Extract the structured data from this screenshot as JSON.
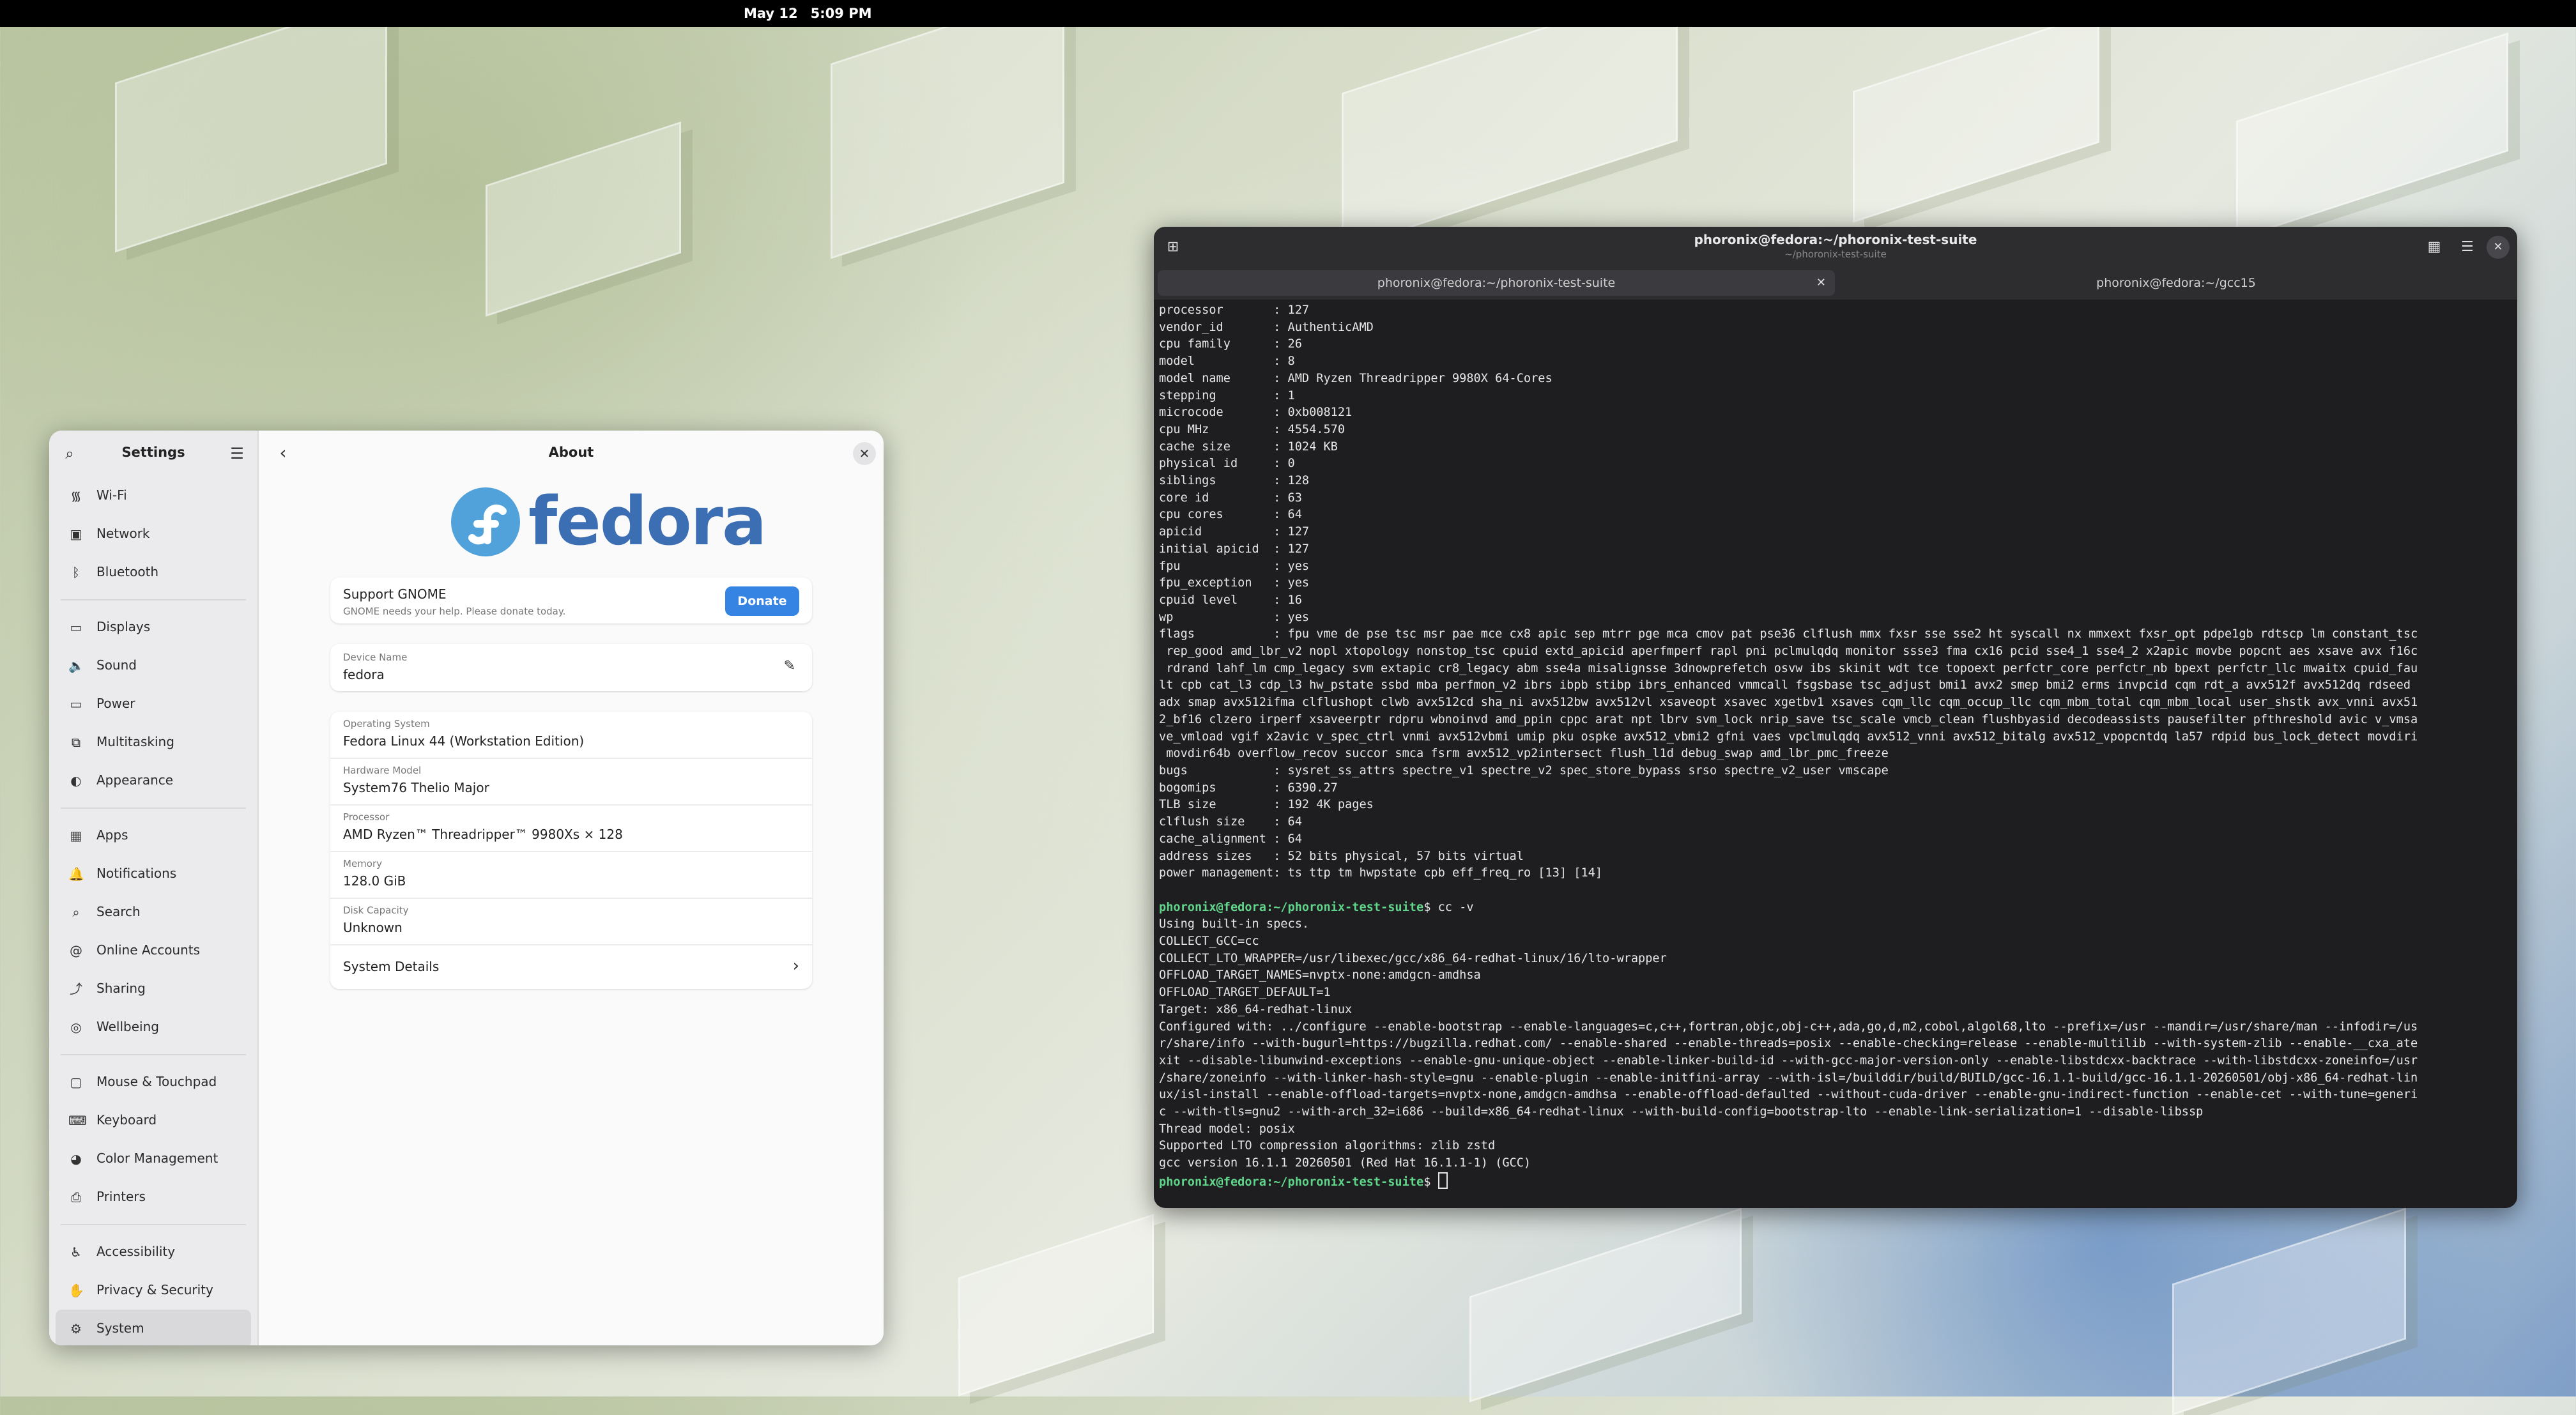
{
  "topbar": {
    "date": "May 12",
    "time": "5:09 PM"
  },
  "settings": {
    "sidebar_title": "Settings",
    "groups": [
      [
        {
          "label": "Wi-Fi",
          "icon": "wifi-icon",
          "glyph": "᯾"
        },
        {
          "label": "Network",
          "icon": "network-icon",
          "glyph": "▣"
        },
        {
          "label": "Bluetooth",
          "icon": "bluetooth-icon",
          "glyph": "ᛒ"
        }
      ],
      [
        {
          "label": "Displays",
          "icon": "display-icon",
          "glyph": "▭"
        },
        {
          "label": "Sound",
          "icon": "sound-icon",
          "glyph": "🔈"
        },
        {
          "label": "Power",
          "icon": "power-icon",
          "glyph": "▭"
        },
        {
          "label": "Multitasking",
          "icon": "multitasking-icon",
          "glyph": "⧉"
        },
        {
          "label": "Appearance",
          "icon": "appearance-icon",
          "glyph": "◐"
        }
      ],
      [
        {
          "label": "Apps",
          "icon": "apps-icon",
          "glyph": "▦"
        },
        {
          "label": "Notifications",
          "icon": "notifications-icon",
          "glyph": "🔔"
        },
        {
          "label": "Search",
          "icon": "search-icon",
          "glyph": "⌕"
        },
        {
          "label": "Online Accounts",
          "icon": "online-accounts-icon",
          "glyph": "@"
        },
        {
          "label": "Sharing",
          "icon": "sharing-icon",
          "glyph": "⤴"
        },
        {
          "label": "Wellbeing",
          "icon": "wellbeing-icon",
          "glyph": "◎"
        }
      ],
      [
        {
          "label": "Mouse & Touchpad",
          "icon": "mouse-icon",
          "glyph": "▢"
        },
        {
          "label": "Keyboard",
          "icon": "keyboard-icon",
          "glyph": "⌨"
        },
        {
          "label": "Color Management",
          "icon": "color-management-icon",
          "glyph": "◕"
        },
        {
          "label": "Printers",
          "icon": "printer-icon",
          "glyph": "⎙"
        }
      ],
      [
        {
          "label": "Accessibility",
          "icon": "accessibility-icon",
          "glyph": "♿"
        },
        {
          "label": "Privacy & Security",
          "icon": "privacy-icon",
          "glyph": "✋"
        },
        {
          "label": "System",
          "icon": "system-icon",
          "glyph": "⚙",
          "active": true
        }
      ]
    ],
    "about": {
      "title": "About",
      "logo_text": "fedora",
      "donate": {
        "title": "Support GNOME",
        "subtitle": "GNOME needs your help. Please donate today.",
        "button": "Donate"
      },
      "device": {
        "label": "Device Name",
        "value": "fedora"
      },
      "info": [
        {
          "label": "Operating System",
          "value": "Fedora Linux 44 (Workstation Edition)"
        },
        {
          "label": "Hardware Model",
          "value": "System76 Thelio Major"
        },
        {
          "label": "Processor",
          "value": "AMD Ryzen™ Threadripper™ 9980Xs × 128"
        },
        {
          "label": "Memory",
          "value": "128.0 GiB"
        },
        {
          "label": "Disk Capacity",
          "value": "Unknown"
        }
      ],
      "details": "System Details"
    }
  },
  "terminal": {
    "title": "phoronix@fedora:~/phoronix-test-suite",
    "subtitle": "~/phoronix-test-suite",
    "tabs": [
      "phoronix@fedora:~/phoronix-test-suite",
      "phoronix@fedora:~/gcc15"
    ],
    "lines": [
      "processor       : 127",
      "vendor_id       : AuthenticAMD",
      "cpu family      : 26",
      "model           : 8",
      "model name      : AMD Ryzen Threadripper 9980X 64-Cores",
      "stepping        : 1",
      "microcode       : 0xb008121",
      "cpu MHz         : 4554.570",
      "cache size      : 1024 KB",
      "physical id     : 0",
      "siblings        : 128",
      "core id         : 63",
      "cpu cores       : 64",
      "apicid          : 127",
      "initial apicid  : 127",
      "fpu             : yes",
      "fpu_exception   : yes",
      "cpuid level     : 16",
      "wp              : yes",
      "flags           : fpu vme de pse tsc msr pae mce cx8 apic sep mtrr pge mca cmov pat pse36 clflush mmx fxsr sse sse2 ht syscall nx mmxext fxsr_opt pdpe1gb rdtscp lm constant_tsc",
      " rep_good amd_lbr_v2 nopl xtopology nonstop_tsc cpuid extd_apicid aperfmperf rapl pni pclmulqdq monitor ssse3 fma cx16 pcid sse4_1 sse4_2 x2apic movbe popcnt aes xsave avx f16c",
      " rdrand lahf_lm cmp_legacy svm extapic cr8_legacy abm sse4a misalignsse 3dnowprefetch osvw ibs skinit wdt tce topoext perfctr_core perfctr_nb bpext perfctr_llc mwaitx cpuid_fau",
      "lt cpb cat_l3 cdp_l3 hw_pstate ssbd mba perfmon_v2 ibrs ibpb stibp ibrs_enhanced vmmcall fsgsbase tsc_adjust bmi1 avx2 smep bmi2 erms invpcid cqm rdt_a avx512f avx512dq rdseed",
      "adx smap avx512ifma clflushopt clwb avx512cd sha_ni avx512bw avx512vl xsaveopt xsavec xgetbv1 xsaves cqm_llc cqm_occup_llc cqm_mbm_total cqm_mbm_local user_shstk avx_vnni avx51",
      "2_bf16 clzero irperf xsaveerptr rdpru wbnoinvd amd_ppin cppc arat npt lbrv svm_lock nrip_save tsc_scale vmcb_clean flushbyasid decodeassists pausefilter pfthreshold avic v_vmsa",
      "ve_vmload vgif x2avic v_spec_ctrl vnmi avx512vbmi umip pku ospke avx512_vbmi2 gfni vaes vpclmulqdq avx512_vnni avx512_bitalg avx512_vpopcntdq la57 rdpid bus_lock_detect movdiri",
      " movdir64b overflow_recov succor smca fsrm avx512_vp2intersect flush_l1d debug_swap amd_lbr_pmc_freeze",
      "bugs            : sysret_ss_attrs spectre_v1 spectre_v2 spec_store_bypass srso spectre_v2_user vmscape",
      "bogomips        : 6390.27",
      "TLB size        : 192 4K pages",
      "clflush size    : 64",
      "cache_alignment : 64",
      "address sizes   : 52 bits physical, 57 bits virtual",
      "power management: ts ttp tm hwpstate cpb eff_freq_ro [13] [14]",
      "",
      "$ cc -v",
      "Using built-in specs.",
      "COLLECT_GCC=cc",
      "COLLECT_LTO_WRAPPER=/usr/libexec/gcc/x86_64-redhat-linux/16/lto-wrapper",
      "OFFLOAD_TARGET_NAMES=nvptx-none:amdgcn-amdhsa",
      "OFFLOAD_TARGET_DEFAULT=1",
      "Target: x86_64-redhat-linux",
      "Configured with: ../configure --enable-bootstrap --enable-languages=c,c++,fortran,objc,obj-c++,ada,go,d,m2,cobol,algol68,lto --prefix=/usr --mandir=/usr/share/man --infodir=/us",
      "r/share/info --with-bugurl=https://bugzilla.redhat.com/ --enable-shared --enable-threads=posix --enable-checking=release --enable-multilib --with-system-zlib --enable-__cxa_ate",
      "xit --disable-libunwind-exceptions --enable-gnu-unique-object --enable-linker-build-id --with-gcc-major-version-only --enable-libstdcxx-backtrace --with-libstdcxx-zoneinfo=/usr",
      "/share/zoneinfo --with-linker-hash-style=gnu --enable-plugin --enable-initfini-array --with-isl=/builddir/build/BUILD/gcc-16.1.1-build/gcc-16.1.1-20260501/obj-x86_64-redhat-lin",
      "ux/isl-install --enable-offload-targets=nvptx-none,amdgcn-amdhsa --enable-offload-defaulted --without-cuda-driver --enable-gnu-indirect-function --enable-cet --with-tune=generi",
      "c --with-tls=gnu2 --with-arch_32=i686 --build=x86_64-redhat-linux --with-build-config=bootstrap-lto --enable-link-serialization=1 --disable-libssp",
      "Thread model: posix",
      "Supported LTO compression algorithms: zlib zstd",
      "gcc version 16.1.1 20260501 (Red Hat 16.1.1-1) (GCC)",
      "$ "
    ],
    "prompt": "phoronix@fedora:~/phoronix-test-suite"
  }
}
